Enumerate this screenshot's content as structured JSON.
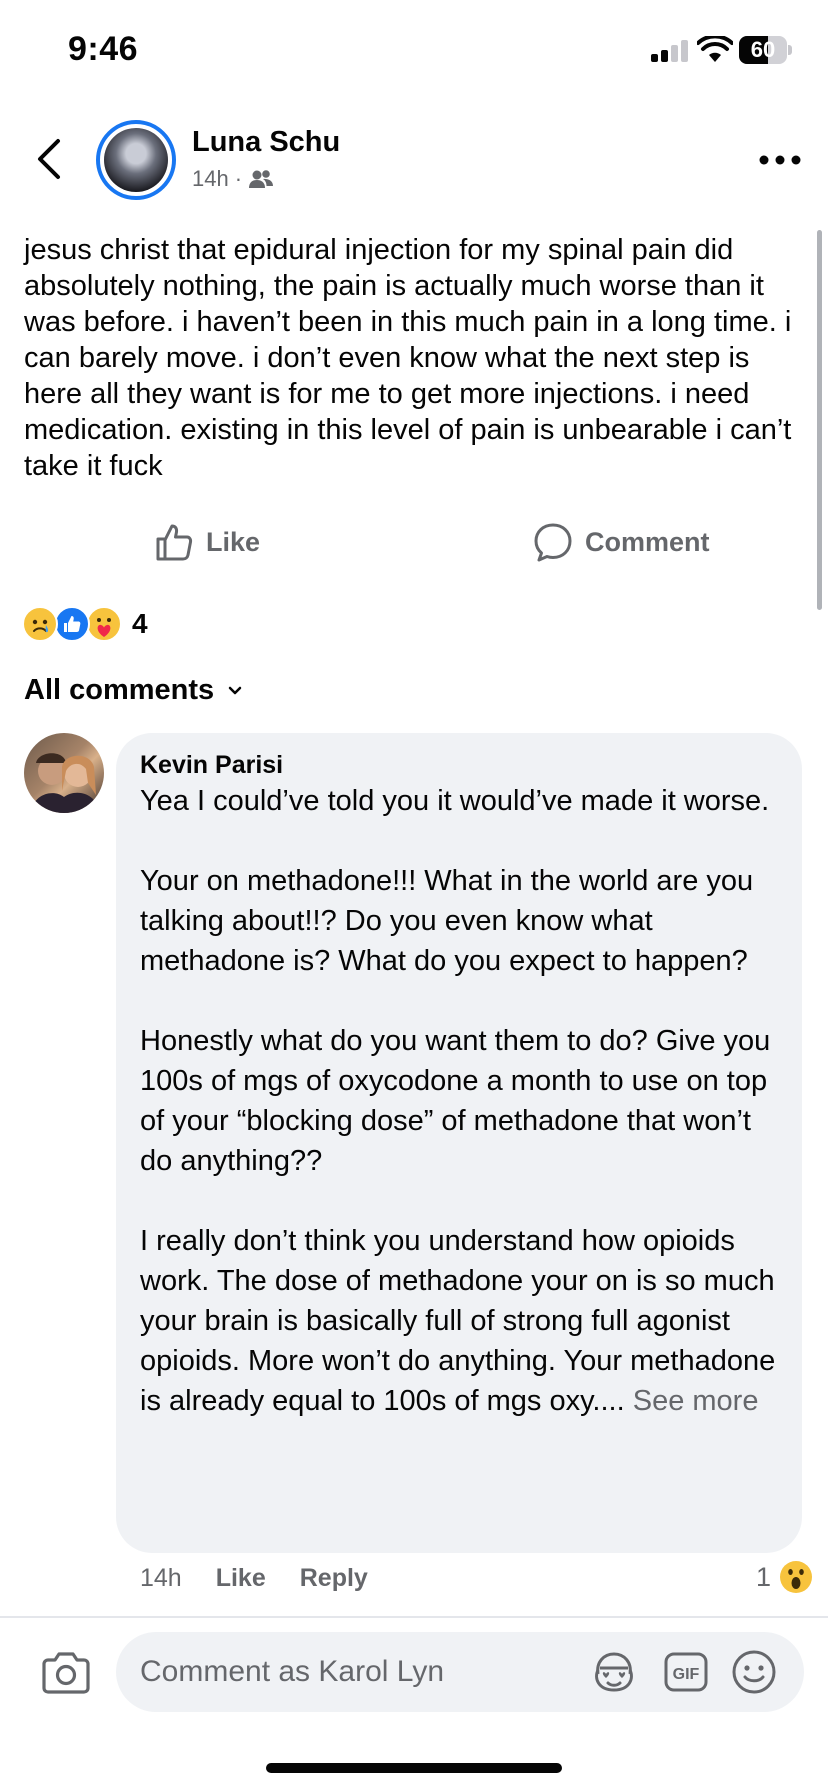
{
  "status_bar": {
    "time": "9:46",
    "battery_percent": "60",
    "battery_level": 0.6,
    "signal_bars": 2
  },
  "post": {
    "author": "Luna Schu",
    "timestamp": "14h",
    "separator": "·",
    "audience_icon": "friends-icon",
    "text": "jesus christ that epidural injection for my spinal pain did absolutely nothing, the pain is actually much worse than it was before. i haven’t been in this much pain in a long time. i can barely move. i don’t even know what the next step is here all they want is for me to get more injections. i need medication. existing in this level of pain is unbearable i can’t take it fuck"
  },
  "actions": {
    "like_label": "Like",
    "comment_label": "Comment"
  },
  "reactions": {
    "icons": [
      "sad-reaction-icon",
      "like-reaction-icon",
      "care-reaction-icon"
    ],
    "count": "4"
  },
  "comments_filter": {
    "label": "All comments"
  },
  "comment": {
    "author": "Kevin Parisi",
    "paragraphs": [
      "Yea I could’ve told you it would’ve made it worse.",
      "Your on methadone!!! What in the world are you talking about!!? Do you even know what methadone is? What do you expect to happen?",
      "Honestly what do you want them to do? Give you 100s of mgs of oxycodone a month to use on top of your “blocking dose” of methadone that won’t do anything??",
      "I really don’t think you understand how opioids work. The dose of methadone your on is so much your brain is basically full of strong full agonist opioids. More won’t do anything. Your methadone is already equal to 100s of mgs oxy...."
    ],
    "see_more": "See more",
    "timestamp": "14h",
    "like_label": "Like",
    "reply_label": "Reply",
    "reaction_count": "1",
    "reaction_icon": "wow-reaction-icon"
  },
  "composer": {
    "placeholder": "Comment as Karol Lyn",
    "camera_icon": "camera-icon",
    "tools": [
      "avatar-sticker-icon",
      "gif-icon",
      "emoji-icon"
    ]
  },
  "colors": {
    "accent": "#1877f2",
    "secondary_text": "#65676b",
    "bubble": "#f0f2f5"
  }
}
